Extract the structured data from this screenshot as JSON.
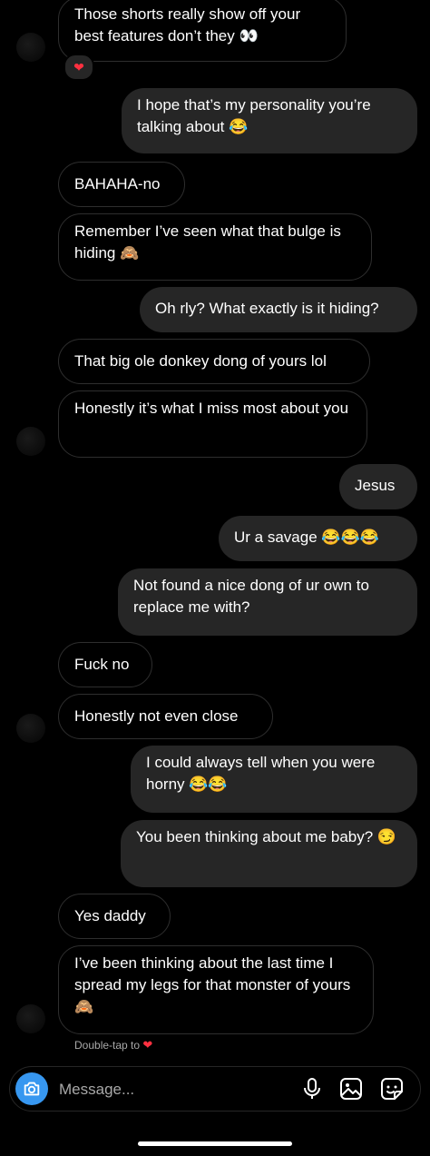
{
  "messages": [
    {
      "from": "them",
      "text": "Those shorts really show off your best features don’t they 👀"
    },
    {
      "from": "me",
      "text": "I hope that’s my personality you’re talking about 😂"
    },
    {
      "from": "them",
      "text": "BAHAHA-no"
    },
    {
      "from": "them",
      "text": "Remember I’ve seen what that bulge is hiding 🙈"
    },
    {
      "from": "me",
      "text": "Oh rly? What exactly is it hiding?"
    },
    {
      "from": "them",
      "text": "That big ole donkey dong of yours lol"
    },
    {
      "from": "them",
      "text": "Honestly it’s what I miss most about you"
    },
    {
      "from": "me",
      "text": "Jesus"
    },
    {
      "from": "me",
      "text": "Ur a savage 😂😂😂"
    },
    {
      "from": "me",
      "text": "Not found a nice dong of ur own to replace me with?"
    },
    {
      "from": "them",
      "text": "Fuck no"
    },
    {
      "from": "them",
      "text": "Honestly not even close"
    },
    {
      "from": "me",
      "text": "I could always tell when you were horny 😂😂"
    },
    {
      "from": "me",
      "text": "You been thinking about me baby? 😏"
    },
    {
      "from": "them",
      "text": "Yes daddy"
    },
    {
      "from": "them",
      "text": "I’ve been thinking about the last time I spread my legs for that monster of yours 🙈"
    }
  ],
  "reaction": {
    "emoji": "❤"
  },
  "hint": {
    "text": "Double-tap to",
    "emoji": "❤"
  },
  "composer": {
    "placeholder": "Message..."
  },
  "icons": {
    "camera": "camera-icon",
    "mic": "microphone-icon",
    "gallery": "gallery-icon",
    "sticker": "sticker-icon"
  },
  "colors": {
    "background": "#000000",
    "outgoing_bubble": "#262626",
    "incoming_border": "#2e2e2e",
    "camera_button": "#3797f0",
    "heart": "#ff3040"
  }
}
